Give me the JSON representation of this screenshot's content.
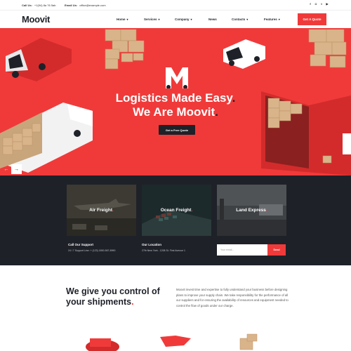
{
  "topbar": {
    "call_label": "Call Us:",
    "call_value": "+1(94) 8a 76 5ab",
    "email_label": "Email Us:",
    "email_value": "office@example.com",
    "social_icons": [
      "facebook-icon",
      "instagram-icon",
      "twitter-icon",
      "youtube-icon"
    ]
  },
  "header": {
    "logo_main": "Moovit",
    "nav": [
      {
        "label": "Home",
        "has_dropdown": true
      },
      {
        "label": "Services",
        "has_dropdown": true
      },
      {
        "label": "Company",
        "has_dropdown": true
      },
      {
        "label": "News",
        "has_dropdown": false
      },
      {
        "label": "Contacts",
        "has_dropdown": true
      },
      {
        "label": "Features",
        "has_dropdown": true
      }
    ],
    "cta": "Get A Quote"
  },
  "hero": {
    "logo_letter": "M",
    "line1": "Logistics Made Easy",
    "line2": "We Are Moovit",
    "button": "Get a Free Quote",
    "prev": "←",
    "next": "→"
  },
  "services": {
    "cards": [
      {
        "label": "Air Freight"
      },
      {
        "label": "Ocean Freight"
      },
      {
        "label": "Land Express"
      }
    ],
    "support_title": "Call Our Support",
    "support_text": "24 / 7 Support Line: + (123) 1800-567-8990",
    "location_title": "Our Location",
    "location_text": "27th New York - 1208 St. First Avenue 1",
    "email_placeholder": "Your email...",
    "send": "Send"
  },
  "about": {
    "title_line1": "We give you control of",
    "title_line2": "your shipments",
    "text": "Moovit invest time and expertise to fully understand your business before designing plans to improve your supply chain. We take responsibility for the performance of all our suppliers and for ensuring the availability of resources and equipment needed to control the flow of goods under our charge."
  },
  "colors": {
    "accent": "#f03a3a",
    "dark": "#1e2128"
  }
}
